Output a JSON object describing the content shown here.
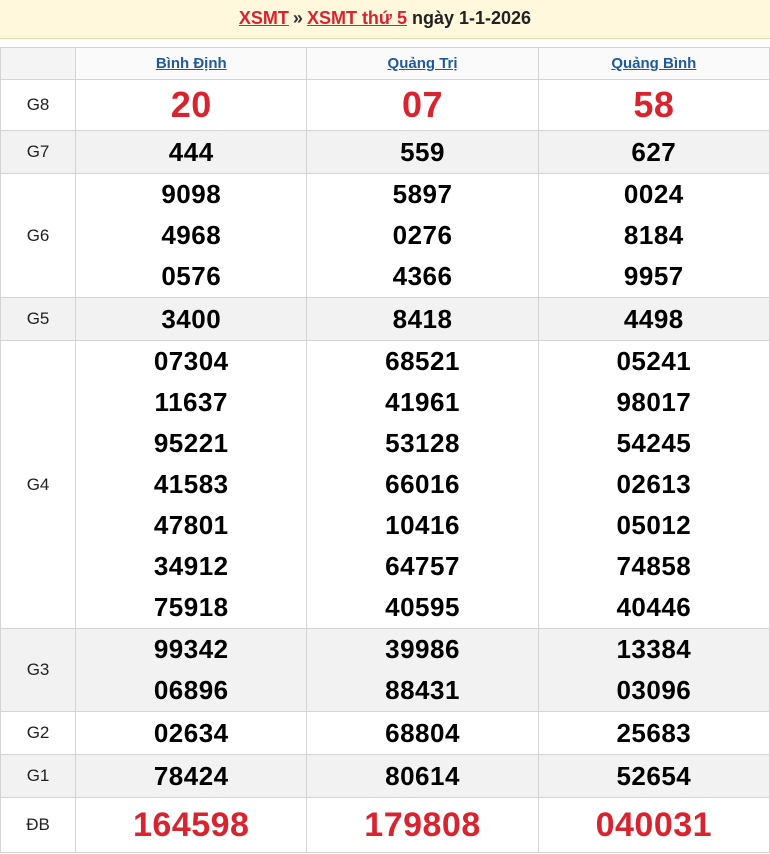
{
  "header": {
    "link1": "XSMT",
    "separator": "»",
    "link2": "XSMT thứ 5",
    "date_text": "ngày 1-1-2026"
  },
  "provinces": [
    "Bình Định",
    "Quảng Trị",
    "Quảng Bình"
  ],
  "prizes": {
    "g8": {
      "label": "G8",
      "values": [
        [
          "20"
        ],
        [
          "07"
        ],
        [
          "58"
        ]
      ]
    },
    "g7": {
      "label": "G7",
      "values": [
        [
          "444"
        ],
        [
          "559"
        ],
        [
          "627"
        ]
      ]
    },
    "g6": {
      "label": "G6",
      "values": [
        [
          "9098",
          "4968",
          "0576"
        ],
        [
          "5897",
          "0276",
          "4366"
        ],
        [
          "0024",
          "8184",
          "9957"
        ]
      ]
    },
    "g5": {
      "label": "G5",
      "values": [
        [
          "3400"
        ],
        [
          "8418"
        ],
        [
          "4498"
        ]
      ]
    },
    "g4": {
      "label": "G4",
      "values": [
        [
          "07304",
          "11637",
          "95221",
          "41583",
          "47801",
          "34912",
          "75918"
        ],
        [
          "68521",
          "41961",
          "53128",
          "66016",
          "10416",
          "64757",
          "40595"
        ],
        [
          "05241",
          "98017",
          "54245",
          "02613",
          "05012",
          "74858",
          "40446"
        ]
      ]
    },
    "g3": {
      "label": "G3",
      "values": [
        [
          "99342",
          "06896"
        ],
        [
          "39986",
          "88431"
        ],
        [
          "13384",
          "03096"
        ]
      ]
    },
    "g2": {
      "label": "G2",
      "values": [
        [
          "02634"
        ],
        [
          "68804"
        ],
        [
          "25683"
        ]
      ]
    },
    "g1": {
      "label": "G1",
      "values": [
        [
          "78424"
        ],
        [
          "80614"
        ],
        [
          "52654"
        ]
      ]
    },
    "db": {
      "label": "ĐB",
      "values": [
        [
          "164598"
        ],
        [
          "179808"
        ],
        [
          "040031"
        ]
      ]
    }
  },
  "colors": {
    "accent_red": "#d9232e",
    "link_blue": "#1f5a9e",
    "header_bg": "#fff8dc",
    "alt_row_bg": "#f2f2f2"
  }
}
